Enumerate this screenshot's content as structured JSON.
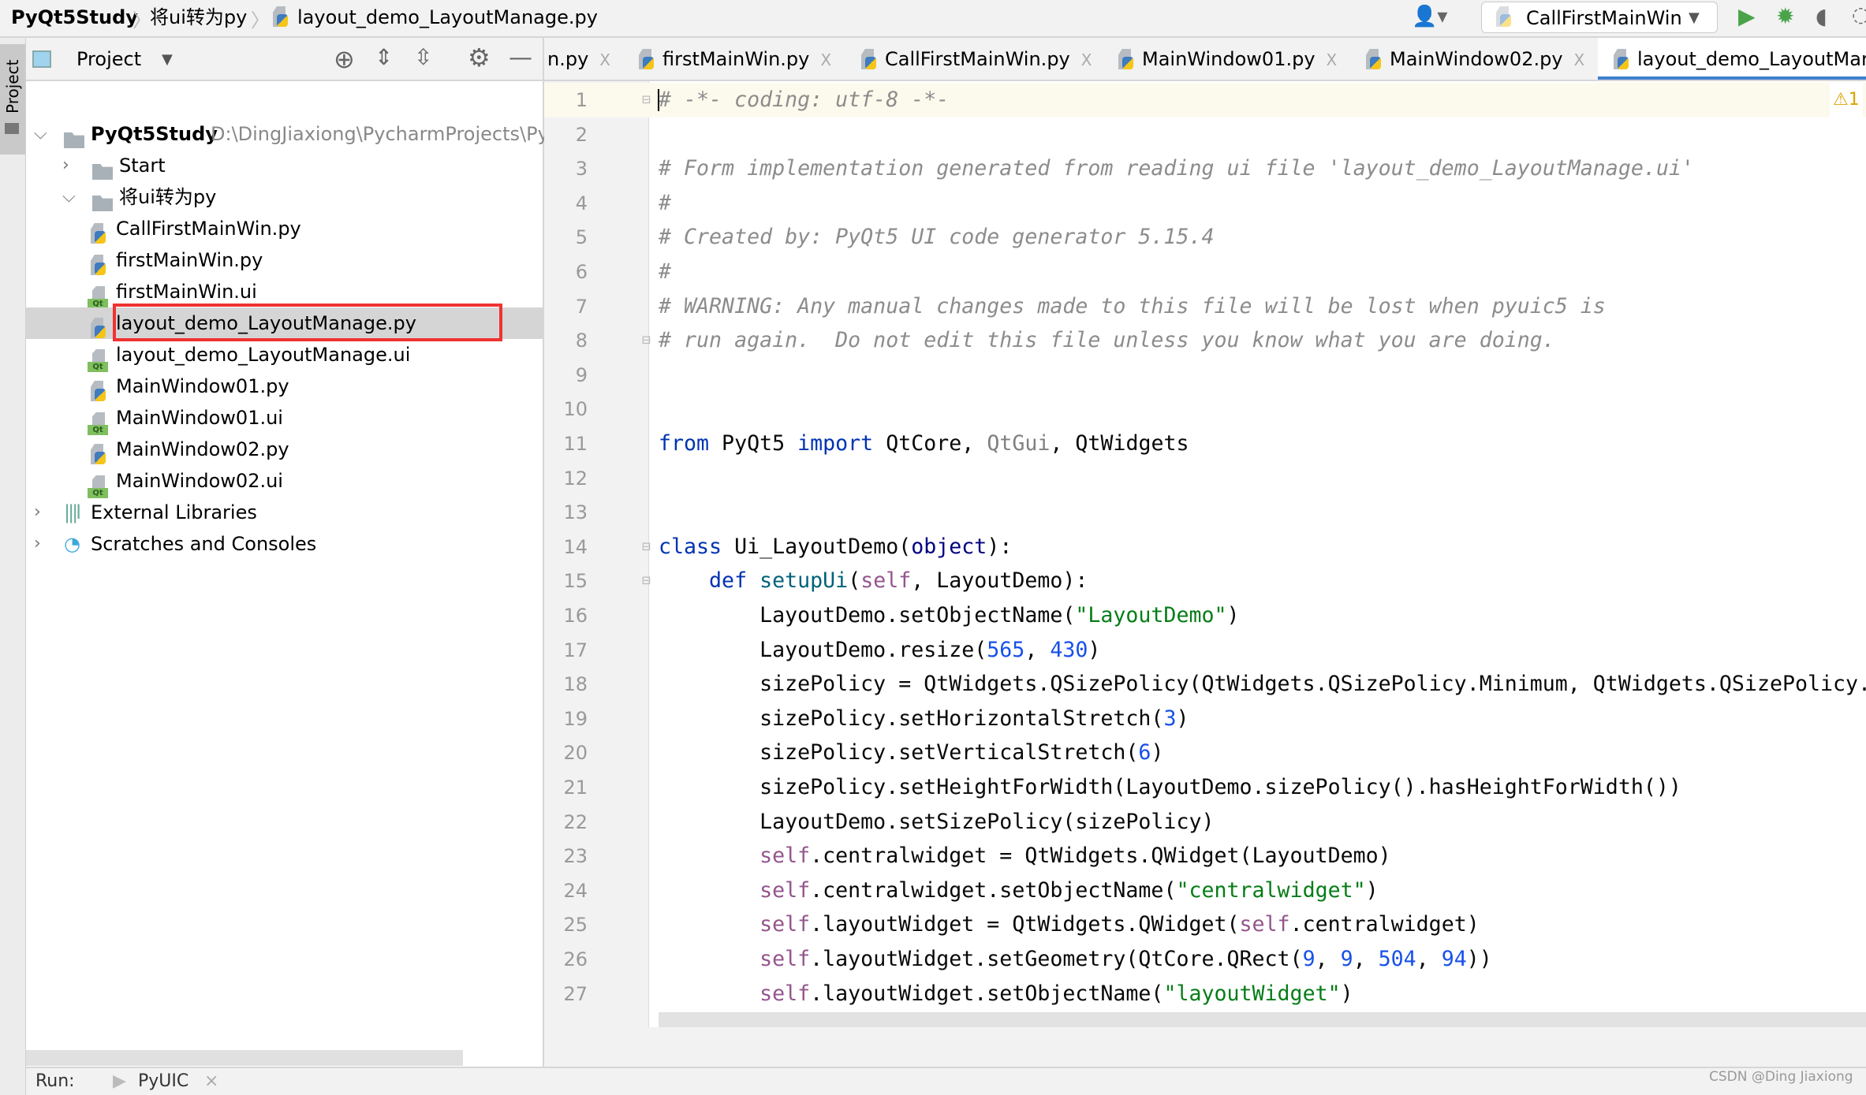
{
  "breadcrumb": [
    "PyQt5Study",
    "将ui转为py",
    "layout_demo_LayoutManage.py"
  ],
  "run_config": "CallFirstMainWin",
  "side_strip_label": "Project",
  "panel": {
    "title": "Project"
  },
  "tree": [
    {
      "label": "PyQt5Study",
      "path": "D:\\DingJiaxiong\\PycharmProjects\\Py",
      "level": 0,
      "icon": "folder-icon",
      "expanded": true,
      "bold": true
    },
    {
      "label": "Start",
      "level": 1,
      "icon": "folder-icon",
      "expanded": false
    },
    {
      "label": "将ui转为py",
      "level": 1,
      "icon": "folder-icon",
      "expanded": true
    },
    {
      "label": "CallFirstMainWin.py",
      "level": 2,
      "icon": "python-file-icon"
    },
    {
      "label": "firstMainWin.py",
      "level": 2,
      "icon": "python-file-icon"
    },
    {
      "label": "firstMainWin.ui",
      "level": 2,
      "icon": "qt-file-icon"
    },
    {
      "label": "layout_demo_LayoutManage.py",
      "level": 2,
      "icon": "python-file-icon",
      "selected": true
    },
    {
      "label": "layout_demo_LayoutManage.ui",
      "level": 2,
      "icon": "qt-file-icon"
    },
    {
      "label": "MainWindow01.py",
      "level": 2,
      "icon": "python-file-icon"
    },
    {
      "label": "MainWindow01.ui",
      "level": 2,
      "icon": "qt-file-icon"
    },
    {
      "label": "MainWindow02.py",
      "level": 2,
      "icon": "python-file-icon"
    },
    {
      "label": "MainWindow02.ui",
      "level": 2,
      "icon": "qt-file-icon"
    },
    {
      "label": "External Libraries",
      "level": 0,
      "icon": "libraries-icon",
      "expanded": false
    },
    {
      "label": "Scratches and Consoles",
      "level": 0,
      "icon": "scratches-icon",
      "expanded": false
    }
  ],
  "tabs": [
    {
      "label": "n.py",
      "icon": false
    },
    {
      "label": "firstMainWin.py",
      "icon": true
    },
    {
      "label": "CallFirstMainWin.py",
      "icon": true
    },
    {
      "label": "MainWindow01.py",
      "icon": true
    },
    {
      "label": "MainWindow02.py",
      "icon": true
    },
    {
      "label": "layout_demo_LayoutMan",
      "icon": true,
      "active": true
    }
  ],
  "warning_count": "1",
  "code": [
    [
      [
        "# -*- coding: utf-8 -*-",
        "comment"
      ]
    ],
    [],
    [
      [
        "# Form implementation generated from reading ui file 'layout_demo_LayoutManage.ui'",
        "comment"
      ]
    ],
    [
      [
        "#",
        "comment"
      ]
    ],
    [
      [
        "# Created by: PyQt5 UI code generator 5.15.4",
        "comment"
      ]
    ],
    [
      [
        "#",
        "comment"
      ]
    ],
    [
      [
        "# WARNING: Any manual changes made to this file will be lost when pyuic5 is",
        "comment"
      ]
    ],
    [
      [
        "# run again.  Do not edit this file unless you know what you are doing.",
        "comment"
      ]
    ],
    [],
    [],
    [
      [
        "from",
        "kw"
      ],
      [
        " PyQt5 ",
        "plain"
      ],
      [
        "import",
        "kw"
      ],
      [
        " QtCore, ",
        "plain"
      ],
      [
        "QtGui",
        "unused"
      ],
      [
        ", QtWidgets",
        "plain"
      ]
    ],
    [],
    [],
    [
      [
        "class",
        "kw"
      ],
      [
        " Ui_LayoutDemo(",
        "plain"
      ],
      [
        "object",
        "builtin"
      ],
      [
        "):",
        "plain"
      ]
    ],
    [
      [
        "    ",
        "plain"
      ],
      [
        "def",
        "kw"
      ],
      [
        " ",
        "plain"
      ],
      [
        "setupUi",
        "fn"
      ],
      [
        "(",
        "plain"
      ],
      [
        "self",
        "self"
      ],
      [
        ", LayoutDemo):",
        "plain"
      ]
    ],
    [
      [
        "        LayoutDemo.setObjectName(",
        "plain"
      ],
      [
        "\"LayoutDemo\"",
        "str"
      ],
      [
        ")",
        "plain"
      ]
    ],
    [
      [
        "        LayoutDemo.resize(",
        "plain"
      ],
      [
        "565",
        "num"
      ],
      [
        ", ",
        "plain"
      ],
      [
        "430",
        "num"
      ],
      [
        ")",
        "plain"
      ]
    ],
    [
      [
        "        sizePolicy = QtWidgets.QSizePolicy(QtWidgets.QSizePolicy.Minimum, QtWidgets.QSizePolicy.",
        "plain"
      ]
    ],
    [
      [
        "        sizePolicy.setHorizontalStretch(",
        "plain"
      ],
      [
        "3",
        "num"
      ],
      [
        ")",
        "plain"
      ]
    ],
    [
      [
        "        sizePolicy.setVerticalStretch(",
        "plain"
      ],
      [
        "6",
        "num"
      ],
      [
        ")",
        "plain"
      ]
    ],
    [
      [
        "        sizePolicy.setHeightForWidth(LayoutDemo.sizePolicy().hasHeightForWidth())",
        "plain"
      ]
    ],
    [
      [
        "        LayoutDemo.setSizePolicy(sizePolicy)",
        "plain"
      ]
    ],
    [
      [
        "        ",
        "plain"
      ],
      [
        "self",
        "self"
      ],
      [
        ".centralwidget = QtWidgets.QWidget(LayoutDemo)",
        "plain"
      ]
    ],
    [
      [
        "        ",
        "plain"
      ],
      [
        "self",
        "self"
      ],
      [
        ".centralwidget.setObjectName(",
        "plain"
      ],
      [
        "\"centralwidget\"",
        "str"
      ],
      [
        ")",
        "plain"
      ]
    ],
    [
      [
        "        ",
        "plain"
      ],
      [
        "self",
        "self"
      ],
      [
        ".layoutWidget = QtWidgets.QWidget(",
        "plain"
      ],
      [
        "self",
        "self"
      ],
      [
        ".centralwidget)",
        "plain"
      ]
    ],
    [
      [
        "        ",
        "plain"
      ],
      [
        "self",
        "self"
      ],
      [
        ".layoutWidget.setGeometry(QtCore.QRect(",
        "plain"
      ],
      [
        "9",
        "num"
      ],
      [
        ", ",
        "plain"
      ],
      [
        "9",
        "num"
      ],
      [
        ", ",
        "plain"
      ],
      [
        "504",
        "num"
      ],
      [
        ", ",
        "plain"
      ],
      [
        "94",
        "num"
      ],
      [
        "))",
        "plain"
      ]
    ],
    [
      [
        "        ",
        "plain"
      ],
      [
        "self",
        "self"
      ],
      [
        ".layoutWidget.setObjectName(",
        "plain"
      ],
      [
        "\"layoutWidget\"",
        "str"
      ],
      [
        ")",
        "plain"
      ]
    ]
  ],
  "runbar": {
    "label": "Run:",
    "tab": "PyUIC"
  },
  "watermark": "CSDN @Ding Jiaxiong"
}
